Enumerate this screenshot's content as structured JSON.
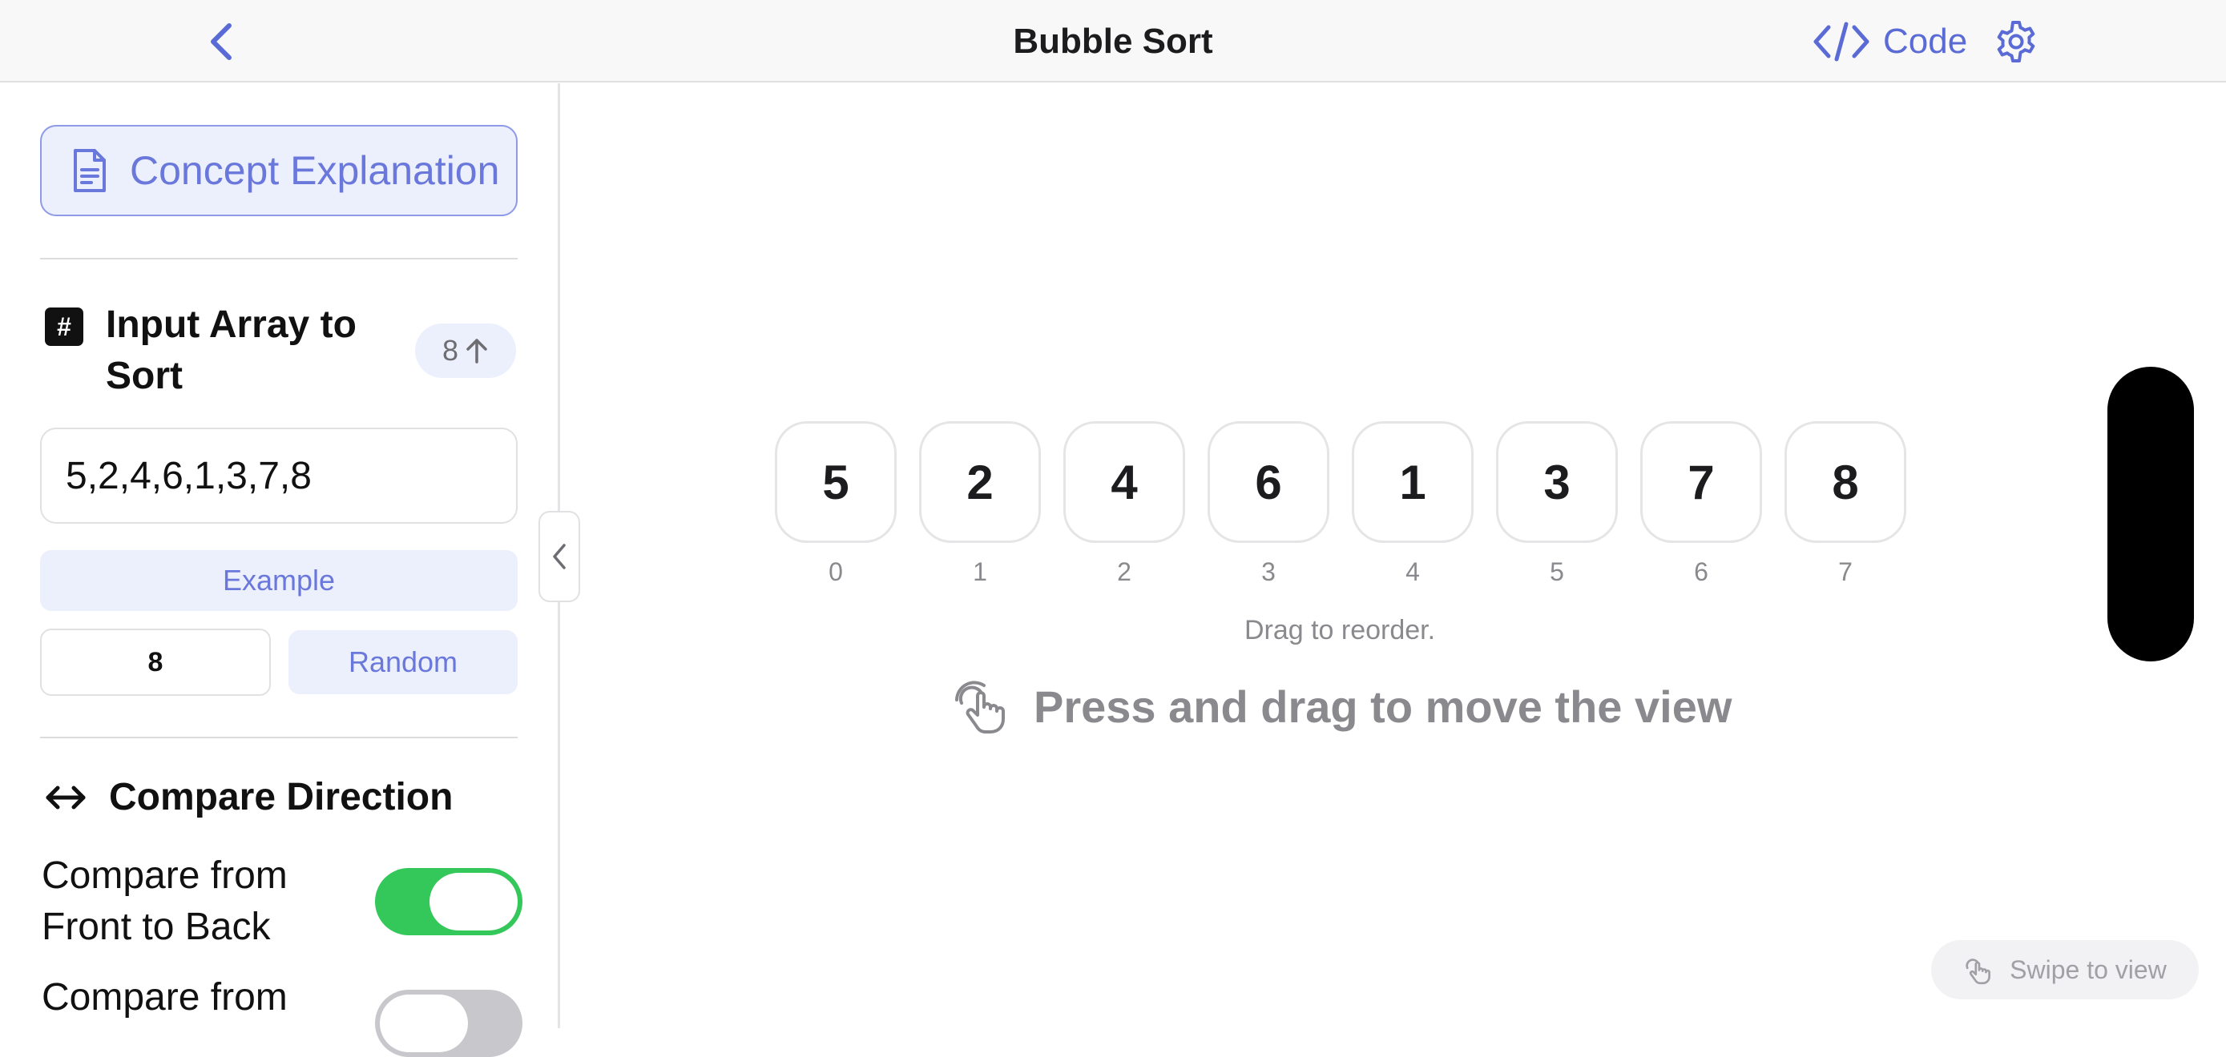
{
  "header": {
    "title": "Bubble Sort",
    "code_label": "Code"
  },
  "sidebar": {
    "concept_label": "Concept Explanation",
    "input_section": {
      "title_line1": "Input Array to",
      "title_line2": "Sort",
      "count_chip": "8",
      "array_value": "5,2,4,6,1,3,7,8",
      "example_label": "Example",
      "size_value": "8",
      "random_label": "Random"
    },
    "direction_section": {
      "title": "Compare Direction",
      "toggles": [
        {
          "line1": "Compare from",
          "line2": "Front to Back",
          "on": true
        },
        {
          "line1": "Compare from",
          "on": false
        }
      ]
    }
  },
  "main": {
    "cells": [
      {
        "value": "5",
        "index": "0"
      },
      {
        "value": "2",
        "index": "1"
      },
      {
        "value": "4",
        "index": "2"
      },
      {
        "value": "6",
        "index": "3"
      },
      {
        "value": "1",
        "index": "4"
      },
      {
        "value": "3",
        "index": "5"
      },
      {
        "value": "7",
        "index": "6"
      },
      {
        "value": "8",
        "index": "7"
      }
    ],
    "drag_hint": "Drag to reorder.",
    "move_hint": "Press and drag to move the view",
    "swipe_label": "Swipe to view"
  },
  "colors": {
    "accent": "#5b6bd6",
    "accent_soft": "#eceffc",
    "toggle_on": "#34c759",
    "toggle_off": "#c7c7cc"
  }
}
